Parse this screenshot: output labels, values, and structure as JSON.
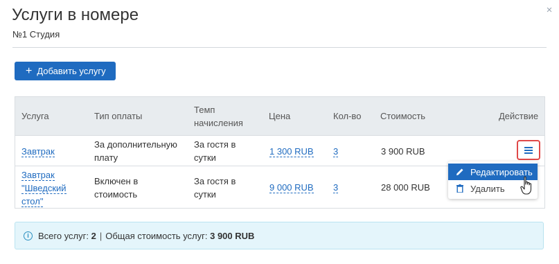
{
  "modal": {
    "title": "Услуги в номере",
    "subtitle": "№1 Студия",
    "close_icon": "×",
    "add_button": {
      "icon": "+",
      "label": "Добавить услугу"
    }
  },
  "table": {
    "headers": {
      "service": "Услуга",
      "payment_type": "Тип оплаты",
      "charge_rate_1": "Темп",
      "charge_rate_2": "начисления",
      "price": "Цена",
      "quantity": "Кол-во",
      "cost": "Стоимость",
      "action": "Действие"
    },
    "rows": [
      {
        "service": [
          "Завтрак"
        ],
        "payment_type": [
          "За дополнительную",
          "плату"
        ],
        "charge_rate": [
          "За гостя в",
          "сутки"
        ],
        "price": "1 300 RUB",
        "quantity": "3",
        "cost": "3 900 RUB"
      },
      {
        "service": [
          "Завтрак",
          "\"Шведский",
          "стол\""
        ],
        "payment_type": [
          "Включен в",
          "стоимость"
        ],
        "charge_rate": [
          "За гостя в",
          "сутки"
        ],
        "price": "9 000 RUB",
        "quantity": "3",
        "cost": "28 000 RUB"
      }
    ]
  },
  "dropdown": {
    "edit_label": "Редактировать",
    "delete_label": "Удалить"
  },
  "summary": {
    "total_label": "Всего услуг:",
    "total_value": "2",
    "separator": "|",
    "cost_label": "Общая стоимость услуг:",
    "cost_value": "3 900 RUB"
  },
  "colors": {
    "primary": "#1f6bc0",
    "highlight_border": "#e04848",
    "info_bg": "#e4f5fb"
  }
}
